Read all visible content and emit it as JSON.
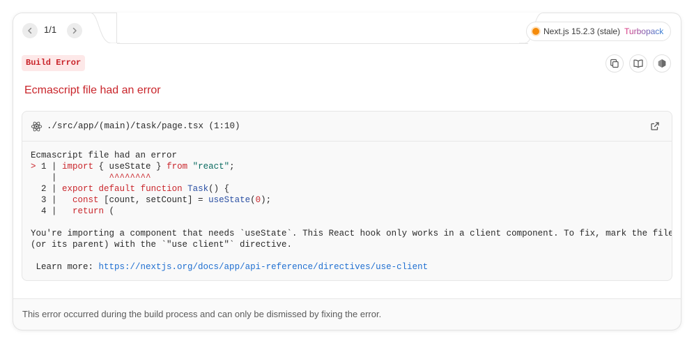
{
  "pager": {
    "prev_icon": "chevron-left-icon",
    "next_icon": "chevron-right-icon",
    "text": "1/1"
  },
  "version": {
    "status_color": "#f58b0a",
    "text": "Next.js 15.2.3 (stale)",
    "bundler": "Turbopack"
  },
  "badge": {
    "label": "Build Error"
  },
  "tools": [
    {
      "name": "copy-icon"
    },
    {
      "name": "docs-book-icon"
    },
    {
      "name": "nodejs-icon"
    }
  ],
  "error": {
    "title": "Ecmascript file had an error"
  },
  "code_frame": {
    "file_path": "./src/app/(main)/task/page.tsx (1:10)",
    "message": "Ecmascript file had an error",
    "lines": {
      "l1_marker": "> ",
      "l1_num": "1 | ",
      "l1_import": "import",
      "l1_mid": " { useState } ",
      "l1_from": "from",
      "l1_sp": " ",
      "l1_str": "\"react\"",
      "l1_end": ";",
      "caret_prefix": "    |          ",
      "caret": "^^^^^^^^",
      "l2_num": "  2 | ",
      "l2_export": "export",
      "l2_sp1": " ",
      "l2_default": "default",
      "l2_sp2": " ",
      "l2_function": "function",
      "l2_sp3": " ",
      "l2_fn": "Task",
      "l2_end": "() {",
      "l3_num": "  3 |   ",
      "l3_const": "const",
      "l3_mid": " [count, setCount] = ",
      "l3_fn": "useState",
      "l3_open": "(",
      "l3_zero": "0",
      "l3_end": ");",
      "l4_num": "  4 |   ",
      "l4_return": "return",
      "l4_end": " ("
    },
    "explanation_1": "You're importing a component that needs `useState`. This React hook only works in a client component. To fix, mark the file",
    "explanation_2": "(or its parent) with the `\"use client\"` directive.",
    "learn_more_label": " Learn more: ",
    "learn_more_url": "https://nextjs.org/docs/app/api-reference/directives/use-client"
  },
  "footer": {
    "text": "This error occurred during the build process and can only be dismissed by fixing the error."
  }
}
